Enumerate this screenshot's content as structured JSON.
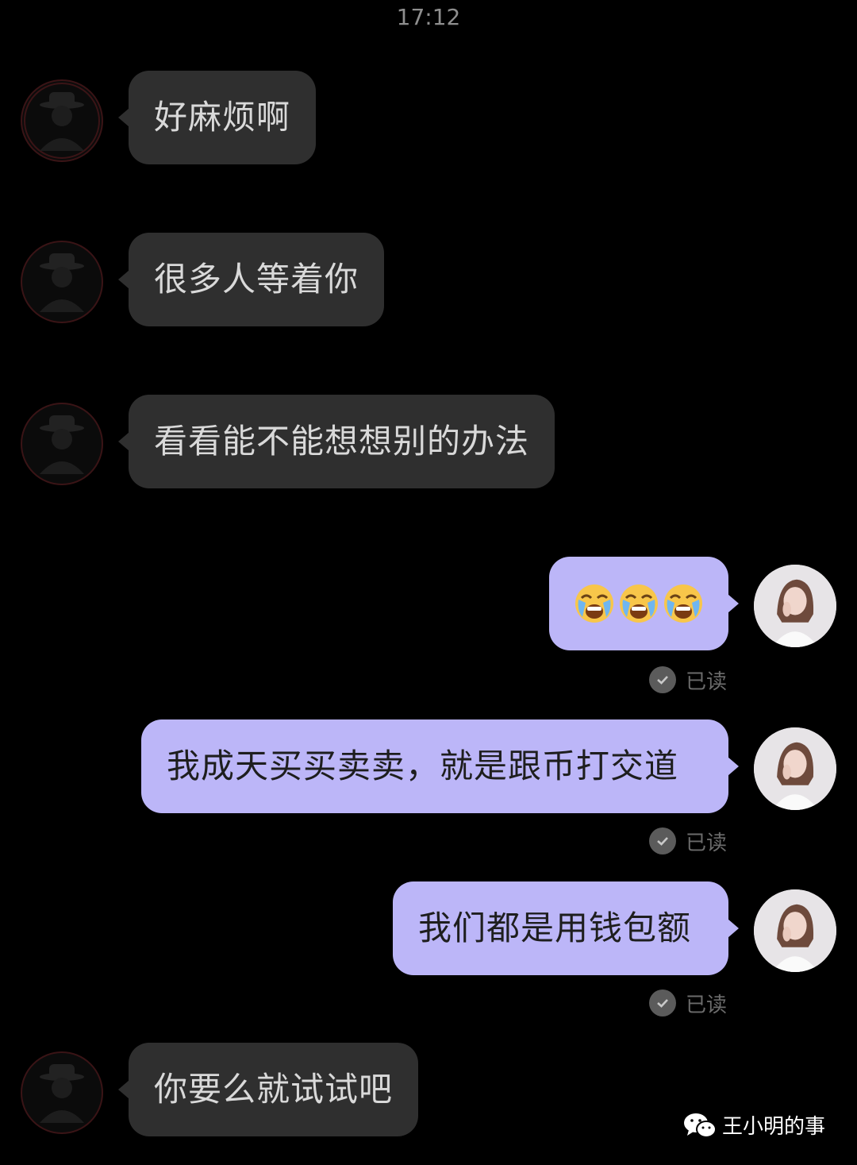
{
  "status_bar": {
    "time": "17:12"
  },
  "messages": [
    {
      "side": "incoming",
      "text": "好麻烦啊"
    },
    {
      "side": "incoming",
      "text": "很多人等着你"
    },
    {
      "side": "incoming",
      "text": "看看能不能想想别的办法"
    },
    {
      "side": "outgoing",
      "emoji": [
        "crying-face-emoji",
        "crying-face-emoji",
        "crying-face-emoji"
      ],
      "status": "已读"
    },
    {
      "side": "outgoing",
      "text": "我成天买买卖卖，就是跟币打交道",
      "status": "已读"
    },
    {
      "side": "outgoing",
      "text": "我们都是用钱包额",
      "status": "已读"
    },
    {
      "side": "incoming",
      "text": "你要么就试试吧"
    }
  ],
  "watermark": {
    "icon": "wechat-icon",
    "text": "王小明的事"
  },
  "colors": {
    "background": "#000000",
    "incoming_bubble": "#2f2f2f",
    "outgoing_bubble": "#bcb6f8",
    "read_status": "#6b6b6b"
  }
}
